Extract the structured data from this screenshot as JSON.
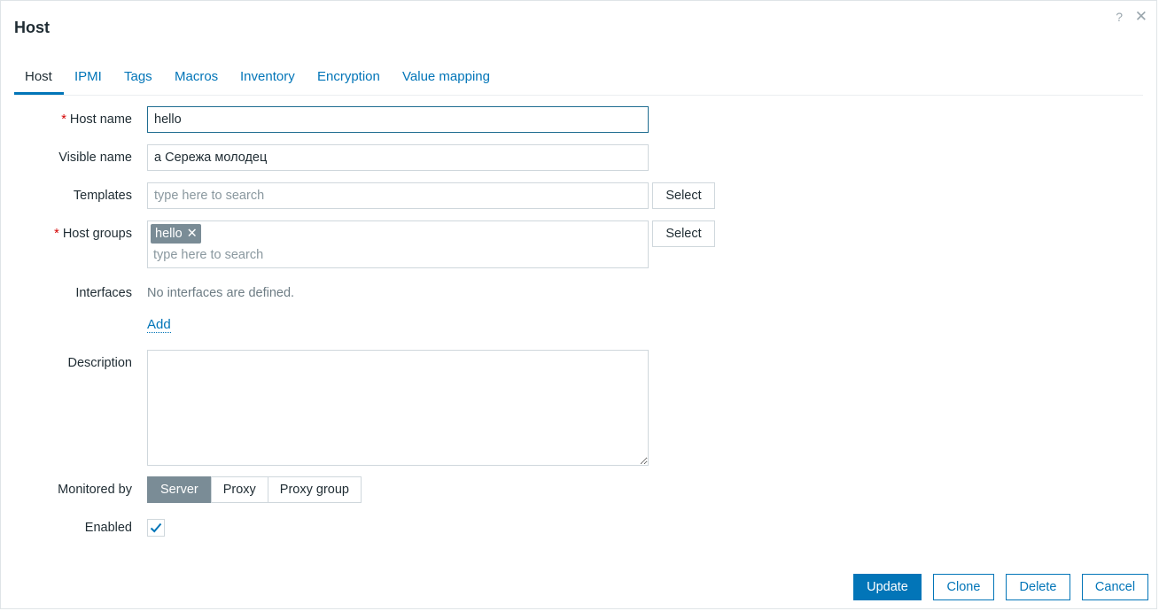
{
  "dialog": {
    "title": "Host",
    "help_icon": "?",
    "close_icon": "✕"
  },
  "tabs": [
    {
      "label": "Host",
      "active": true
    },
    {
      "label": "IPMI"
    },
    {
      "label": "Tags"
    },
    {
      "label": "Macros"
    },
    {
      "label": "Inventory"
    },
    {
      "label": "Encryption"
    },
    {
      "label": "Value mapping"
    }
  ],
  "form": {
    "host_name": {
      "label": "Host name",
      "required": "*",
      "value": "hello"
    },
    "visible_name": {
      "label": "Visible name",
      "value": "а Сережа молодец"
    },
    "templates": {
      "label": "Templates",
      "placeholder": "type here to search",
      "select_label": "Select"
    },
    "host_groups": {
      "label": "Host groups",
      "required": "*",
      "chips": [
        {
          "label": "hello",
          "remove_icon": "✕"
        }
      ],
      "placeholder": "type here to search",
      "select_label": "Select"
    },
    "interfaces": {
      "label": "Interfaces",
      "empty_text": "No interfaces are defined.",
      "add_label": "Add"
    },
    "description": {
      "label": "Description",
      "value": ""
    },
    "monitored_by": {
      "label": "Monitored by",
      "options": [
        {
          "label": "Server",
          "selected": true
        },
        {
          "label": "Proxy"
        },
        {
          "label": "Proxy group"
        }
      ]
    },
    "enabled": {
      "label": "Enabled",
      "checked": true
    }
  },
  "footer": {
    "update_label": "Update",
    "clone_label": "Clone",
    "delete_label": "Delete",
    "cancel_label": "Cancel"
  },
  "colors": {
    "accent": "#0275b8",
    "selected_segment": "#7a8c96",
    "required": "#d40000"
  }
}
